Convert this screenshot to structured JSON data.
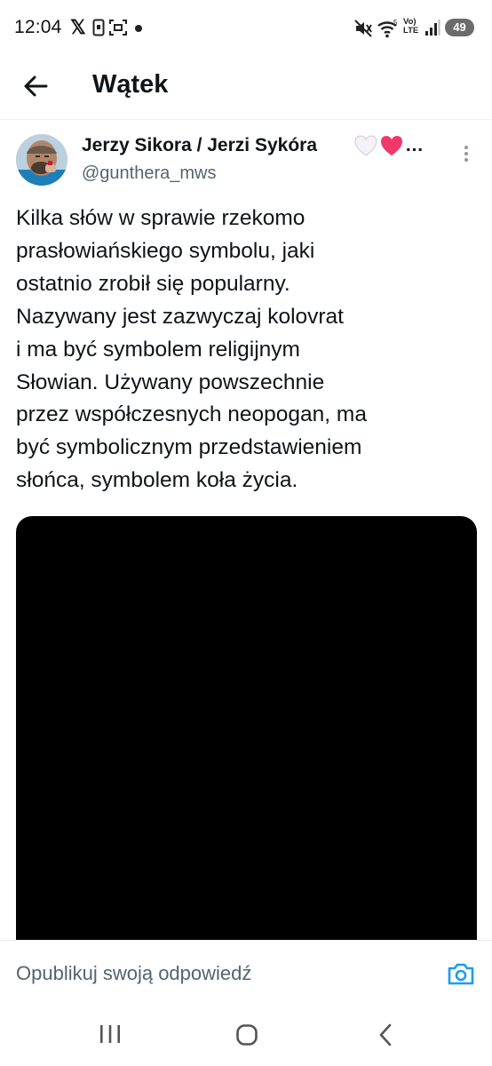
{
  "status_bar": {
    "time": "12:04",
    "battery": "49",
    "network_label_top": "Vo)",
    "network_label_bottom": "LTE",
    "wifi_tag": "5"
  },
  "header": {
    "title": "Wątek"
  },
  "tweet": {
    "author_name": "Jerzy Sikora / Jerzi Sykóra",
    "author_suffix": "…",
    "author_handle": "@gunthera_mws",
    "text_lines": [
      "Kilka słów w sprawie rzekomo",
      "prasłowiańskiego symbolu, jaki",
      "ostatnio zrobił się popularny.",
      "Nazywany jest zazwyczaj kolovrat",
      "i ma być symbolem religijnym",
      "Słowian. Używany powszechnie",
      "przez współczesnych neopogan, ma",
      "być symbolicznym przedstawieniem",
      "słońca, symbolem koła życia."
    ]
  },
  "reply": {
    "placeholder": "Opublikuj swoją odpowiedź"
  },
  "colors": {
    "accent": "#1d9bf0",
    "text_primary": "#0f1419",
    "text_secondary": "#536471",
    "divider": "#eff3f4",
    "heart_white": "#f4f1f7",
    "heart_pink": "#f0386b"
  },
  "icons": {
    "back": "arrow-left-icon",
    "more": "vertical-dots-icon",
    "camera": "camera-icon",
    "recents": "recents-icon",
    "home": "home-icon",
    "nav_back": "chevron-left-icon"
  }
}
